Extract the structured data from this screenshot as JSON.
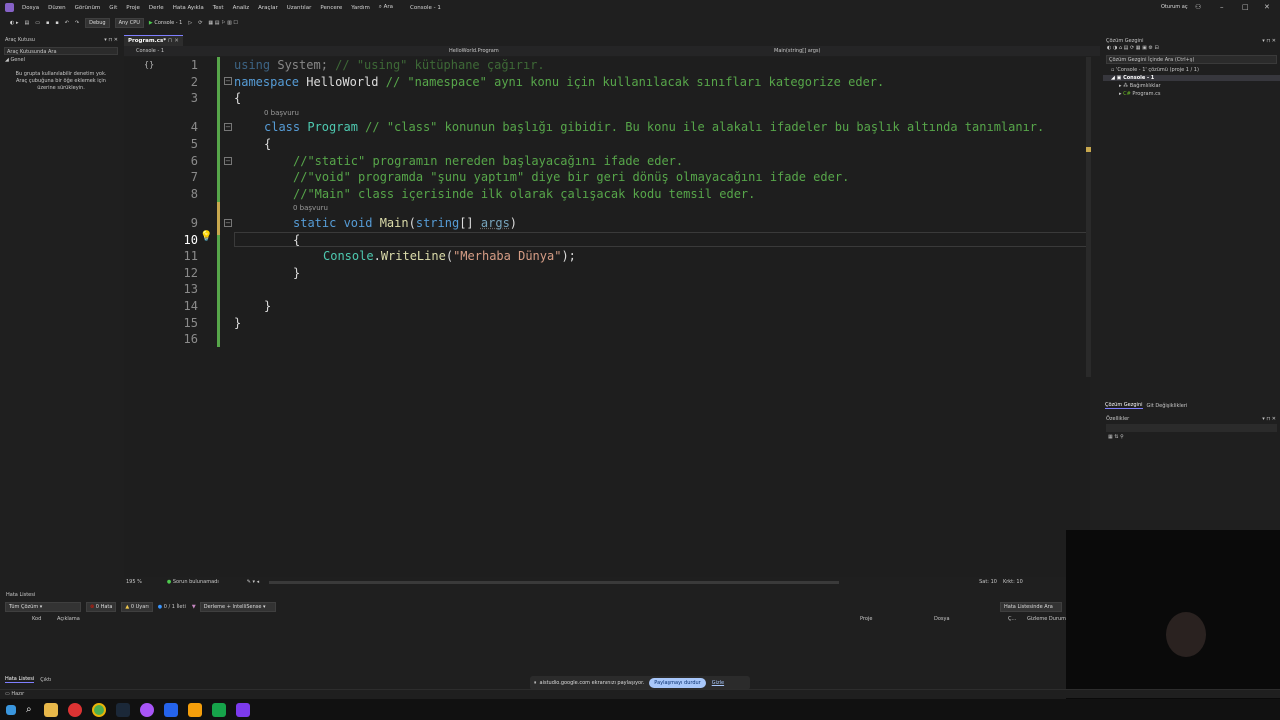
{
  "menu": [
    "Dosya",
    "Düzen",
    "Görünüm",
    "Git",
    "Proje",
    "Derle",
    "Hata Ayıkla",
    "Test",
    "Analiz",
    "Araçlar",
    "Uzantılar",
    "Pencere",
    "Yardım"
  ],
  "search_label": "Ara",
  "window_title": "Console - 1",
  "user_label": "Oturum aç",
  "toolbar": {
    "config": "Debug",
    "platform": "Any CPU",
    "run_label": "Console - 1"
  },
  "toolbox": {
    "title": "Araç Kutusu",
    "search_placeholder": "Araç Kutusunda Ara",
    "group": "Genel",
    "empty_text": "Bu grupta kullanılabilir denetim yok. Araç çubuğuna bir öğe eklemek için üzerine sürükleyin."
  },
  "editor": {
    "tab": "Program.cs*",
    "nav_project": "Console - 1",
    "nav_class": "HelloWorld.Program",
    "nav_member": "Main(string[] args)",
    "refs1": "0 başvuru",
    "refs2": "0 başvuru",
    "line_numbers": [
      "1",
      "2",
      "3",
      "4",
      "5",
      "6",
      "7",
      "8",
      "9",
      "10",
      "11",
      "12",
      "13",
      "14",
      "15",
      "16"
    ],
    "code": {
      "l1_kw": "using",
      "l1_id": " System;",
      "l1_cmt": " // \"using\" kütüphane çağırır.",
      "l2_kw": "namespace",
      "l2_id": " HelloWorld",
      "l2_cmt": " // \"namespace\" aynı konu için kullanılacak sınıfları kategorize eder.",
      "brace_open": "{",
      "brace_close": "}",
      "l4_kw": "class",
      "l4_cls": " Program",
      "l4_cmt": " // \"class\" konunun başlığı gibidir. Bu konu ile alakalı ifadeler bu başlık altında tanımlanır.",
      "l6_cmt": "//\"static\" programın nereden başlayacağını ifade eder.",
      "l7_cmt": "//\"void\" programda \"şunu yaptım\" diye bir geri dönüş olmayacağını ifade eder.",
      "l8_cmt": "//\"Main\" class içerisinde ilk olarak çalışacak kodu temsil eder.",
      "l9_kw1": "static",
      "l9_kw2": " void",
      "l9_fn": " Main",
      "l9_p1": "(",
      "l9_kw3": "string",
      "l9_p2": "[] ",
      "l9_arg": "args",
      "l9_p3": ")",
      "l11_cls": "Console",
      "l11_dot": ".",
      "l11_fn": "WriteLine",
      "l11_p1": "(",
      "l11_str": "\"Merhaba Dünya\"",
      "l11_p2": ");"
    }
  },
  "editor_status": {
    "zoom": "195 %",
    "issues": "Sorun bulunamadı",
    "line": "Sat: 10",
    "char": "Krkt: 10"
  },
  "solution": {
    "title": "Çözüm Gezgini",
    "search_placeholder": "Çözüm Gezgini İçinde Ara (Ctrl+ş)",
    "root": "'Console - 1' çözümü (proje 1 / 1)",
    "project": "Console - 1",
    "deps": "Bağımlılıklar",
    "file": "Program.cs",
    "tabs": [
      "Çözüm Gezgini",
      "Git Değişiklikleri"
    ]
  },
  "properties": {
    "title": "Özellikler"
  },
  "errors": {
    "title": "Hata Listesi",
    "scope": "Tüm Çözüm",
    "errors": "0 Hata",
    "warnings": "0 Uyarı",
    "messages": "0 / 1 İleti",
    "filter": "Derleme + IntelliSense",
    "search": "Hata Listesinde Ara",
    "columns": [
      "Kod",
      "Açıklama",
      "Proje",
      "Dosya",
      "Ç...",
      "Gizleme Durum"
    ],
    "bottom_tabs": [
      "Hata Listesi",
      "Çıktı"
    ]
  },
  "status": {
    "ready": "Hazır"
  },
  "share": {
    "text": "aistudio.google.com ekranınızı paylaşıyor.",
    "stop": "Paylaşmayı durdur",
    "hide": "Gizle"
  },
  "colors": {
    "accent": "#7f7fff",
    "keyword": "#569cd6",
    "comment": "#57a64a",
    "string": "#d69d85",
    "type": "#4ec9b0",
    "method": "#dcdcaa",
    "gutter_change": "#57a64a"
  }
}
